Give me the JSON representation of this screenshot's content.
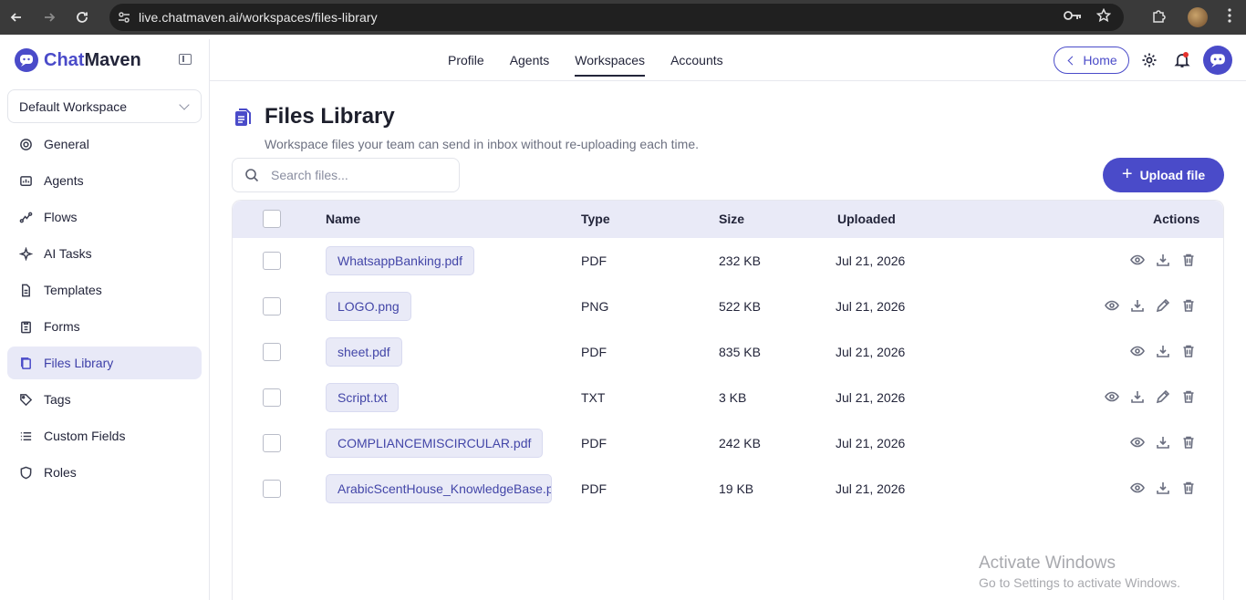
{
  "browser": {
    "url": "live.chatmaven.ai/workspaces/files-library"
  },
  "brand": {
    "part1": "Chat",
    "part2": "Maven"
  },
  "workspace_select": {
    "value": "Default Workspace"
  },
  "sidebar": {
    "items": [
      {
        "label": "General",
        "icon": "gear-icon"
      },
      {
        "label": "Agents",
        "icon": "agents-icon"
      },
      {
        "label": "Flows",
        "icon": "flows-icon"
      },
      {
        "label": "AI Tasks",
        "icon": "sparkle-icon"
      },
      {
        "label": "Templates",
        "icon": "template-icon"
      },
      {
        "label": "Forms",
        "icon": "clipboard-icon"
      },
      {
        "label": "Files Library",
        "icon": "files-icon",
        "active": true
      },
      {
        "label": "Tags",
        "icon": "tag-icon"
      },
      {
        "label": "Custom Fields",
        "icon": "list-icon"
      },
      {
        "label": "Roles",
        "icon": "shield-icon"
      }
    ]
  },
  "topnav": {
    "tabs": [
      "Profile",
      "Agents",
      "Workspaces",
      "Accounts"
    ],
    "active_tab": "Workspaces",
    "home_label": "Home"
  },
  "page": {
    "title": "Files Library",
    "subtitle": "Workspace files your team can send in inbox without re-uploading each time."
  },
  "search": {
    "placeholder": "Search files...",
    "value": ""
  },
  "upload_button": {
    "label": "Upload file"
  },
  "table": {
    "headers": {
      "name": "Name",
      "type": "Type",
      "size": "Size",
      "uploaded": "Uploaded",
      "actions": "Actions"
    },
    "rows": [
      {
        "name": "WhatsappBanking.pdf",
        "type": "PDF",
        "size": "232 KB",
        "uploaded": "Jul 21, 2026",
        "editable": false
      },
      {
        "name": "LOGO.png",
        "type": "PNG",
        "size": "522 KB",
        "uploaded": "Jul 21, 2026",
        "editable": true
      },
      {
        "name": "sheet.pdf",
        "type": "PDF",
        "size": "835 KB",
        "uploaded": "Jul 21, 2026",
        "editable": false
      },
      {
        "name": "Script.txt",
        "type": "TXT",
        "size": "3 KB",
        "uploaded": "Jul 21, 2026",
        "editable": true
      },
      {
        "name": "COMPLIANCEMISCIRCULAR.pdf",
        "type": "PDF",
        "size": "242 KB",
        "uploaded": "Jul 21, 2026",
        "editable": false
      },
      {
        "name": "ArabicScentHouse_KnowledgeBase.pdf",
        "type": "PDF",
        "size": "19 KB",
        "uploaded": "Jul 21, 2026",
        "editable": false
      }
    ]
  },
  "watermark": {
    "line1": "Activate Windows",
    "line2": "Go to Settings to activate Windows."
  },
  "colors": {
    "accent": "#4a4bc9",
    "active_bg": "#e8e9f7",
    "header_bg": "#e9eaf7"
  }
}
